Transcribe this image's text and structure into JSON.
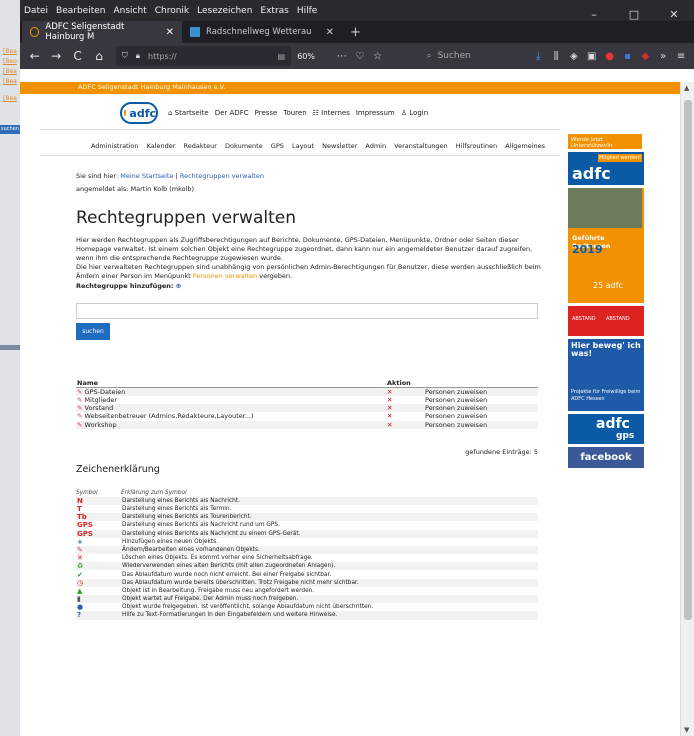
{
  "desktop": {
    "links": [
      "[Bea",
      "[Beo",
      "[Bea",
      "[Bea",
      "[Bea"
    ],
    "button": "suchen"
  },
  "browser": {
    "menu": [
      "Datei",
      "Bearbeiten",
      "Ansicht",
      "Chronik",
      "Lesezeichen",
      "Extras",
      "Hilfe"
    ],
    "window_controls": [
      "–",
      "□",
      "✕"
    ],
    "tabs": [
      {
        "title": "ADFC Seligenstadt Hainburg M",
        "close": "✕"
      },
      {
        "title": "Radschnellweg Wetterau",
        "close": "✕"
      }
    ],
    "new_tab": "+",
    "url": "https://",
    "zoom": "60%",
    "search_placeholder": "Suchen",
    "nav": {
      "back": "←",
      "forward": "→",
      "reload": "C",
      "home": "⌂"
    }
  },
  "site": {
    "header_bar": "ADFC Seligenstadt Hainburg Mainhausen e.V.",
    "logo": "adfc",
    "topnav": [
      "⌂ Startseite",
      "Der ADFC",
      "Presse",
      "Touren",
      "☷ Internes",
      "Impressum",
      "♙ Login"
    ],
    "adminnav": [
      "Administration",
      "Kalender",
      "Redakteur",
      "Dokumente",
      "GPS",
      "Layout",
      "Newsletter",
      "Admin",
      "Veranstaltungen",
      "Hilfsroutinen",
      "Allgemeines"
    ],
    "breadcrumb": {
      "prefix": "Sie sind hier:",
      "home": "Meine Startseite",
      "sep": "|",
      "current": "Rechtegruppen verwalten"
    },
    "logged_in": "angemeldet als: Martin Kolb (mkolb)",
    "title": "Rechtegruppen verwalten",
    "intro1": "Hier werden Rechtegruppen als Zugriffsberechtigungen auf Berichte, Dokumente, GPS-Dateien, Menüpunkte, Ordner oder Seiten dieser Homepage verwaltet. Ist einem solchen Objekt eine Rechtegruppe zugeordnet, dann kann nur ein angemeldeter Benutzer darauf zugreifen, wenn ihm die entsprechende Rechtegruppe zugewiesen wurde.",
    "intro2": "Die hier verwalteten Rechtegruppen sind unabhängig von persönlichen Admin-Berechtigungen für Benutzer, diese werden ausschließlich beim Ändern einer Person im Menüpunkt",
    "intro2_link": "Personen verwalten",
    "intro2_end": "vergeben.",
    "add_label": "Rechtegruppe hinzufügen:",
    "search_button": "suchen",
    "table": {
      "headers": [
        "Name",
        "Aktion",
        ""
      ],
      "rows": [
        {
          "name": "GPS-Dateien",
          "assign": "Personen zuweisen"
        },
        {
          "name": "Mitglieder",
          "assign": "Personen zuweisen"
        },
        {
          "name": "Vorstand",
          "assign": "Personen zuweisen"
        },
        {
          "name": "Webseitenbetreuer (Admins,Redakteure,Layouter...)",
          "assign": "Personen zuweisen"
        },
        {
          "name": "Workshop",
          "assign": "Personen zuweisen"
        }
      ]
    },
    "count": "gefundene Einträge: 5",
    "legend_title": "Zeichenerklärung",
    "legend_headers": [
      "Symbol",
      "Erklärung zum Symbol"
    ],
    "legend": [
      {
        "sym": "N",
        "color": "#d22",
        "text": "Darstellung eines Berichts als Nachricht."
      },
      {
        "sym": "T",
        "color": "#d22",
        "text": "Darstellung eines Berichts als Termin."
      },
      {
        "sym": "Tb",
        "color": "#d22",
        "text": "Darstellung eines Berichts als Tourenbericht."
      },
      {
        "sym": "GPS",
        "color": "#d22",
        "text": "Darstellung eines Berichts als Nachricht rund um GPS."
      },
      {
        "sym": "GPS",
        "color": "#d22",
        "text": "Darstellung eines Berichts als Nachricht zu einem GPS-Gerät."
      },
      {
        "sym": "+",
        "color": "#2a60b0",
        "text": "Hinzufügen eines neuen Objekts."
      },
      {
        "sym": "✎",
        "color": "#c44",
        "text": "Ändern/Bearbeiten eines vorhandenen Objekts."
      },
      {
        "sym": "✕",
        "color": "#d00",
        "text": "Löschen eines Objekts. Es kommt vorher eine Sicherheitsabfrage."
      },
      {
        "sym": "♻",
        "color": "#2a9a2a",
        "text": "Wiederverwenden eines alten Berichts (mit allen zugeordneten Anlagen)."
      },
      {
        "sym": "✔",
        "color": "#2a9a2a",
        "text": "Das Ablaufdatum wurde noch nicht erreicht. Bei einer Freigabe sichtbar."
      },
      {
        "sym": "◷",
        "color": "#d22",
        "text": "Das Ablaufdatum wurde bereits überschritten. Trotz Freigabe nicht mehr sichtbar."
      },
      {
        "sym": "▲",
        "color": "#2a9a2a",
        "text": "Objekt ist in Bearbeitung. Freigabe muss neu angefordert werden."
      },
      {
        "sym": "▮",
        "color": "#555",
        "text": "Objekt wartet auf Freigabe. Der Admin muss noch freigeben."
      },
      {
        "sym": "●",
        "color": "#2a60b0",
        "text": "Objekt wurde freigegeben. Ist veröffentlicht, solange Ablaufdatum nicht überschritten."
      },
      {
        "sym": "?",
        "color": "#2a60b0",
        "text": "Hilfe zu Text-Formatierungen in den Eingabefeldern und weitere Hinweise."
      }
    ],
    "sidebar": {
      "unterstuetzer": "Werde jetzt Unterstützer/in",
      "mitglied": "Mitglied werden!",
      "mitglied_logo": "adfc",
      "radtouren": "Geführte Radtouren",
      "year": "2019",
      "jubilee": "25 adfc",
      "abstand_a": "ABSTAND",
      "abstand_b": "ABSTAND",
      "frei_head": "Hier beweg' ich was!",
      "frei_text": "Projekte für Freiwillige beim ADFC Hessen",
      "gps_a": "adfc",
      "gps_b": "gps",
      "facebook": "facebook"
    }
  }
}
